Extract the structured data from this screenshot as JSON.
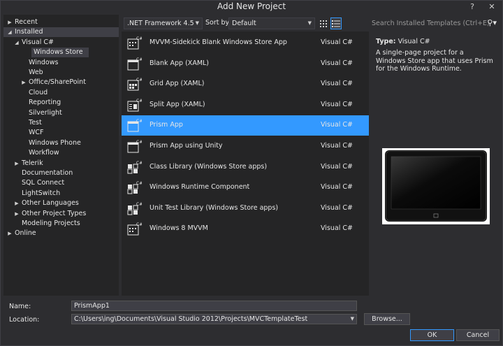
{
  "window": {
    "title": "Add New Project",
    "help_label": "?",
    "close_label": "✕"
  },
  "tree": {
    "items": [
      {
        "label": "Recent",
        "level": 0,
        "arrow": "▶"
      },
      {
        "label": "Installed",
        "level": 0,
        "arrow": "◢"
      },
      {
        "label": "Visual C#",
        "level": 1,
        "arrow": "◢"
      },
      {
        "label": "Windows Store",
        "level": 2,
        "arrow": ""
      },
      {
        "label": "Windows",
        "level": 2,
        "arrow": ""
      },
      {
        "label": "Web",
        "level": 2,
        "arrow": ""
      },
      {
        "label": "Office/SharePoint",
        "level": 2,
        "arrow": "▶"
      },
      {
        "label": "Cloud",
        "level": 2,
        "arrow": ""
      },
      {
        "label": "Reporting",
        "level": 2,
        "arrow": ""
      },
      {
        "label": "Silverlight",
        "level": 2,
        "arrow": ""
      },
      {
        "label": "Test",
        "level": 2,
        "arrow": ""
      },
      {
        "label": "WCF",
        "level": 2,
        "arrow": ""
      },
      {
        "label": "Windows Phone",
        "level": 2,
        "arrow": ""
      },
      {
        "label": "Workflow",
        "level": 2,
        "arrow": ""
      },
      {
        "label": "Telerik",
        "level": 1,
        "arrow": "▶"
      },
      {
        "label": "Documentation",
        "level": 1,
        "arrow": ""
      },
      {
        "label": "SQL Connect",
        "level": 1,
        "arrow": ""
      },
      {
        "label": "LightSwitch",
        "level": 1,
        "arrow": ""
      },
      {
        "label": "Other Languages",
        "level": 1,
        "arrow": "▶"
      },
      {
        "label": "Other Project Types",
        "level": 1,
        "arrow": "▶"
      },
      {
        "label": "Modeling Projects",
        "level": 1,
        "arrow": ""
      },
      {
        "label": "Online",
        "level": 0,
        "arrow": "▶"
      }
    ]
  },
  "toolbar": {
    "framework": ".NET Framework 4.5",
    "sort_label": "Sort by:",
    "sort_value": "Default",
    "grid_view_icon": "grid-view-icon",
    "list_view_icon": "list-view-icon"
  },
  "search": {
    "placeholder": "Search Installed Templates (Ctrl+E)",
    "icon": "search-icon"
  },
  "templates": [
    {
      "name": "MVVM-Sidekick Blank Windows Store App",
      "lang": "Visual C#",
      "icon": "mvvm"
    },
    {
      "name": "Blank App (XAML)",
      "lang": "Visual C#",
      "icon": "blank"
    },
    {
      "name": "Grid App (XAML)",
      "lang": "Visual C#",
      "icon": "grid"
    },
    {
      "name": "Split App (XAML)",
      "lang": "Visual C#",
      "icon": "split"
    },
    {
      "name": "Prism App",
      "lang": "Visual C#",
      "icon": "blank"
    },
    {
      "name": "Prism App using Unity",
      "lang": "Visual C#",
      "icon": "blank"
    },
    {
      "name": "Class Library (Windows Store apps)",
      "lang": "Visual C#",
      "icon": "library"
    },
    {
      "name": "Windows Runtime Component",
      "lang": "Visual C#",
      "icon": "library"
    },
    {
      "name": "Unit Test Library (Windows Store apps)",
      "lang": "Visual C#",
      "icon": "library"
    },
    {
      "name": "Windows 8 MVVM",
      "lang": "Visual C#",
      "icon": "mvvm"
    }
  ],
  "details": {
    "type_key": "Type:",
    "type_value": "Visual C#",
    "description": "A single-page project for a Windows Store app that uses Prism for the Windows Runtime."
  },
  "form": {
    "name_label": "Name:",
    "name_value": "PrismApp1",
    "location_label": "Location:",
    "location_value": "C:\\Users\\ing\\Documents\\Visual Studio 2012\\Projects\\MVCTemplateTest",
    "browse_label": "Browse...",
    "ok_label": "OK",
    "cancel_label": "Cancel"
  },
  "colors": {
    "accent": "#3399ff",
    "background": "#2d2d30",
    "panel": "#252526"
  }
}
